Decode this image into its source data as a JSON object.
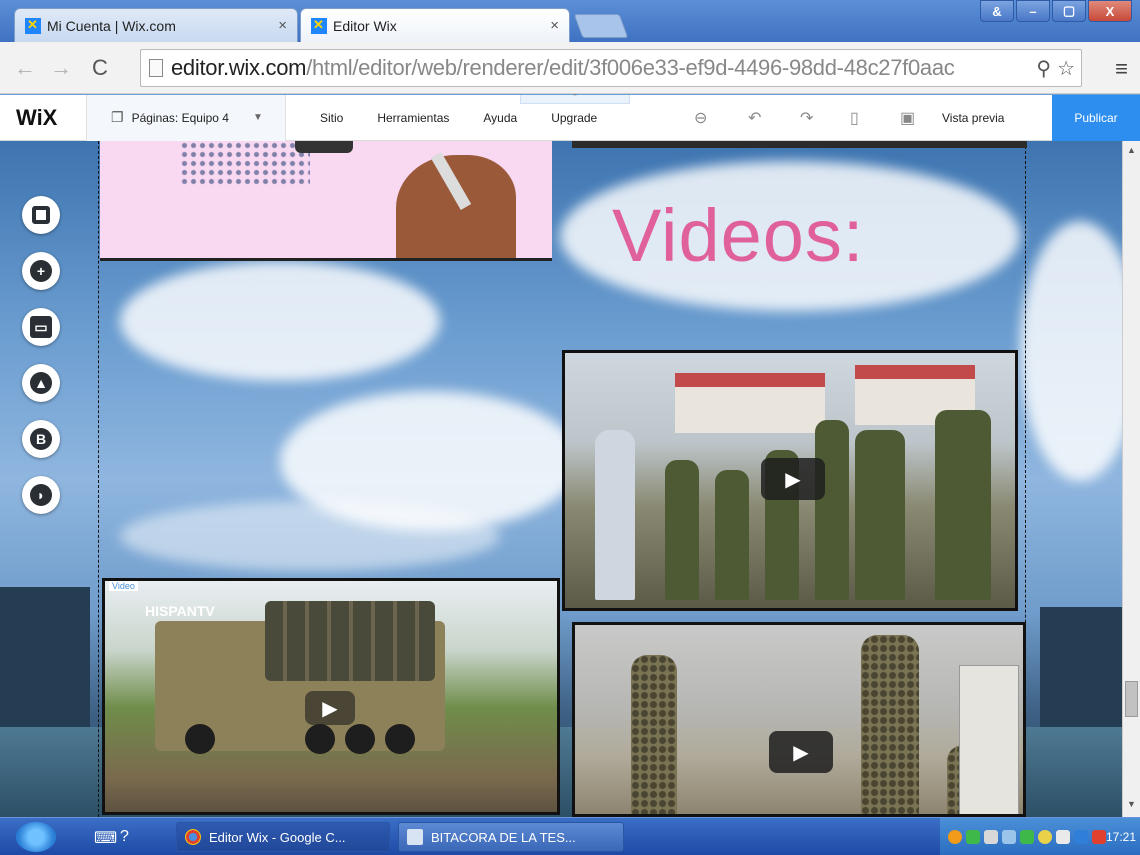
{
  "browser": {
    "tabs": [
      {
        "title": "Mi Cuenta | Wix.com",
        "close": "×"
      },
      {
        "title": "Editor Wix",
        "close": "×"
      }
    ],
    "window_buttons": [
      "&",
      "–",
      "▢",
      "X"
    ],
    "url_host": "editor.wix.com",
    "url_path": "/html/editor/web/renderer/edit/3f006e33-ef9d-4496-98dd-48c27f0aac"
  },
  "wix": {
    "logo": "WiX",
    "pages_label": "Páginas: Equipo 4",
    "menu": [
      "Sitio",
      "Herramientas",
      "Ayuda",
      "Upgrade"
    ],
    "preview": "Vista previa",
    "publish": "Publicar"
  },
  "canvas": {
    "heading": "Videos:",
    "video_tag": "Video",
    "channel_logo_a": "HI",
    "channel_logo_b": "SPANTV"
  },
  "taskbar": {
    "tasks": [
      "Editor Wix - Google C...",
      "BITACORA DE LA TES..."
    ],
    "clock": "17:21"
  },
  "colors": {
    "wix_blue": "#2d8ef0",
    "heading_pink": "#e0609b"
  }
}
